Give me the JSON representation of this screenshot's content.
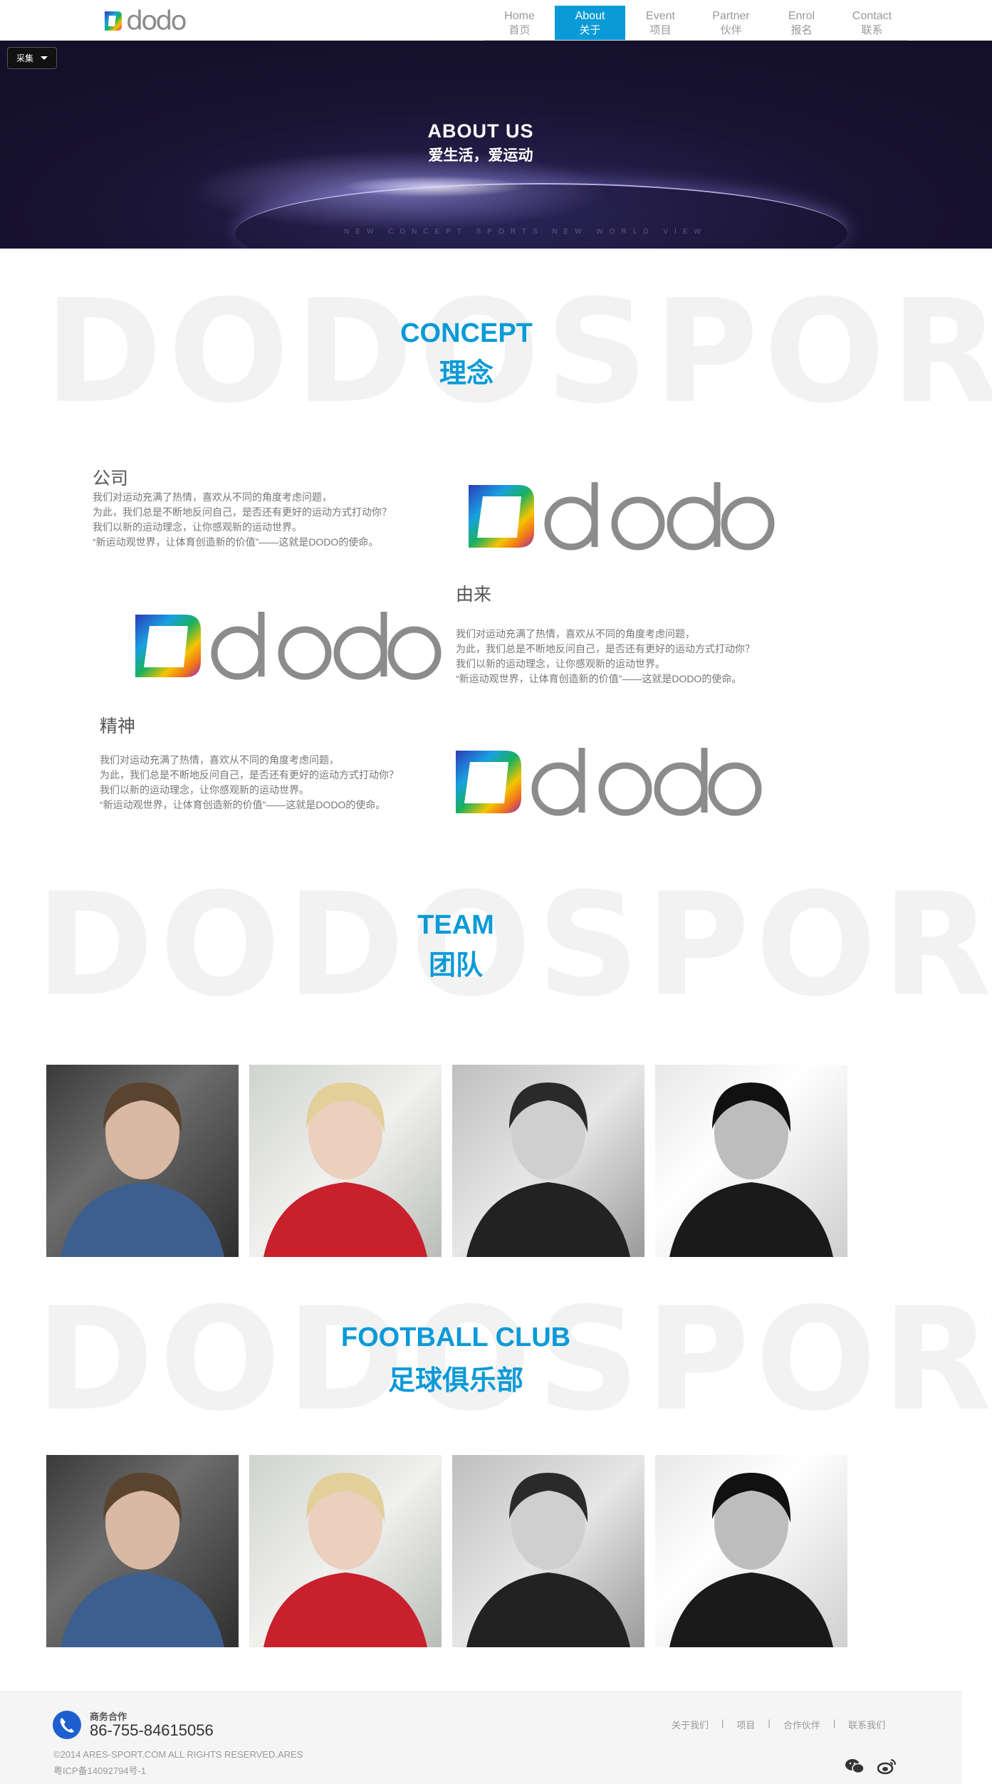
{
  "header": {
    "logo_text": "dodo",
    "nav": [
      {
        "en": "Home",
        "zh": "首页",
        "active": false
      },
      {
        "en": "About",
        "zh": "关于",
        "active": true
      },
      {
        "en": "Event",
        "zh": "项目",
        "active": false
      },
      {
        "en": "Partner",
        "zh": "伙伴",
        "active": false
      },
      {
        "en": "Enrol",
        "zh": "报名",
        "active": false
      },
      {
        "en": "Contact",
        "zh": "联系",
        "active": false
      }
    ]
  },
  "collect_button": "采集",
  "banner": {
    "title": "ABOUT US",
    "subtitle": "爱生活，爱运动",
    "tagline": "NEW CONCEPT SPORTS NEW WORLD VIEW"
  },
  "background_word": "DODOSPORT",
  "concept": {
    "heading_en": "CONCEPT",
    "heading_zh": "理念",
    "blocks": [
      {
        "title": "公司",
        "lines": [
          "我们对运动充满了热情，喜欢从不同的角度考虑问题，",
          "为此，我们总是不断地反问自己，是否还有更好的运动方式打动你？",
          "我们以新的运动理念，让你感观新的运动世界。",
          "“新运动观世界，让体育创造新的价值”——这就是DODO的使命。"
        ]
      },
      {
        "title": "由来",
        "lines": [
          "我们对运动充满了热情，喜欢从不同的角度考虑问题，",
          "为此，我们总是不断地反问自己，是否还有更好的运动方式打动你？",
          "我们以新的运动理念，让你感观新的运动世界。",
          "“新运动观世界，让体育创造新的价值”——这就是DODO的使命。"
        ]
      },
      {
        "title": "精神",
        "lines": [
          "我们对运动充满了热情，喜欢从不同的角度考虑问题，",
          "为此，我们总是不断地反问自己，是否还有更好的运动方式打动你？",
          "我们以新的运动理念，让你感观新的运动世界。",
          "“新运动观世界，让体育创造新的价值”——这就是DODO的使命。"
        ]
      }
    ]
  },
  "team": {
    "heading_en": "TEAM",
    "heading_zh": "团队"
  },
  "club": {
    "heading_en": "FOOTBALL CLUB",
    "heading_zh": "足球俱乐部"
  },
  "footer": {
    "biz_label": "商务合作",
    "phone": "86-755-84615056",
    "copyright": "©2014 ARES-SPORT.COM ALL RIGHTS RESERVED.ARES",
    "icp": "粤ICP备14092794号-1",
    "links": [
      "关于我们",
      "项目",
      "合作伙伴",
      "联系我们"
    ]
  },
  "colors": {
    "accent": "#0a9ad7",
    "banner_bg": "#1a1434",
    "footer_bg": "#f5f5f5"
  }
}
